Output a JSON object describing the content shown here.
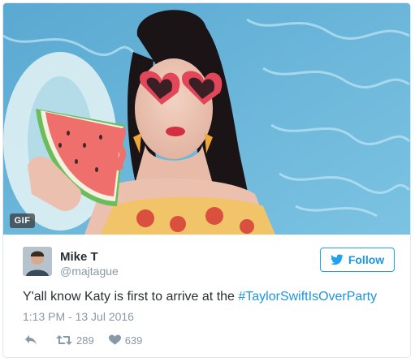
{
  "media": {
    "badge_label": "GIF",
    "alt_icon": "gif-badge"
  },
  "author": {
    "name": "Mike T",
    "handle": "@majtague",
    "avatar_icon": "avatar"
  },
  "follow_button": {
    "label": "Follow",
    "icon": "twitter-bird-icon",
    "color": "#1b95e0"
  },
  "tweet": {
    "text": "Y'all know Katy is first to arrive at the ",
    "hashtag": "#TaylorSwiftIsOverParty",
    "timestamp": "1:13 PM - 13 Jul 2016"
  },
  "actions": {
    "reply_icon": "reply-icon",
    "retweet_icon": "retweet-icon",
    "retweet_count": "289",
    "like_icon": "heart-icon",
    "like_count": "639"
  },
  "colors": {
    "text": "#292f33",
    "muted": "#8899a6",
    "link": "#1b95e0",
    "border": "#e1e8ed"
  }
}
